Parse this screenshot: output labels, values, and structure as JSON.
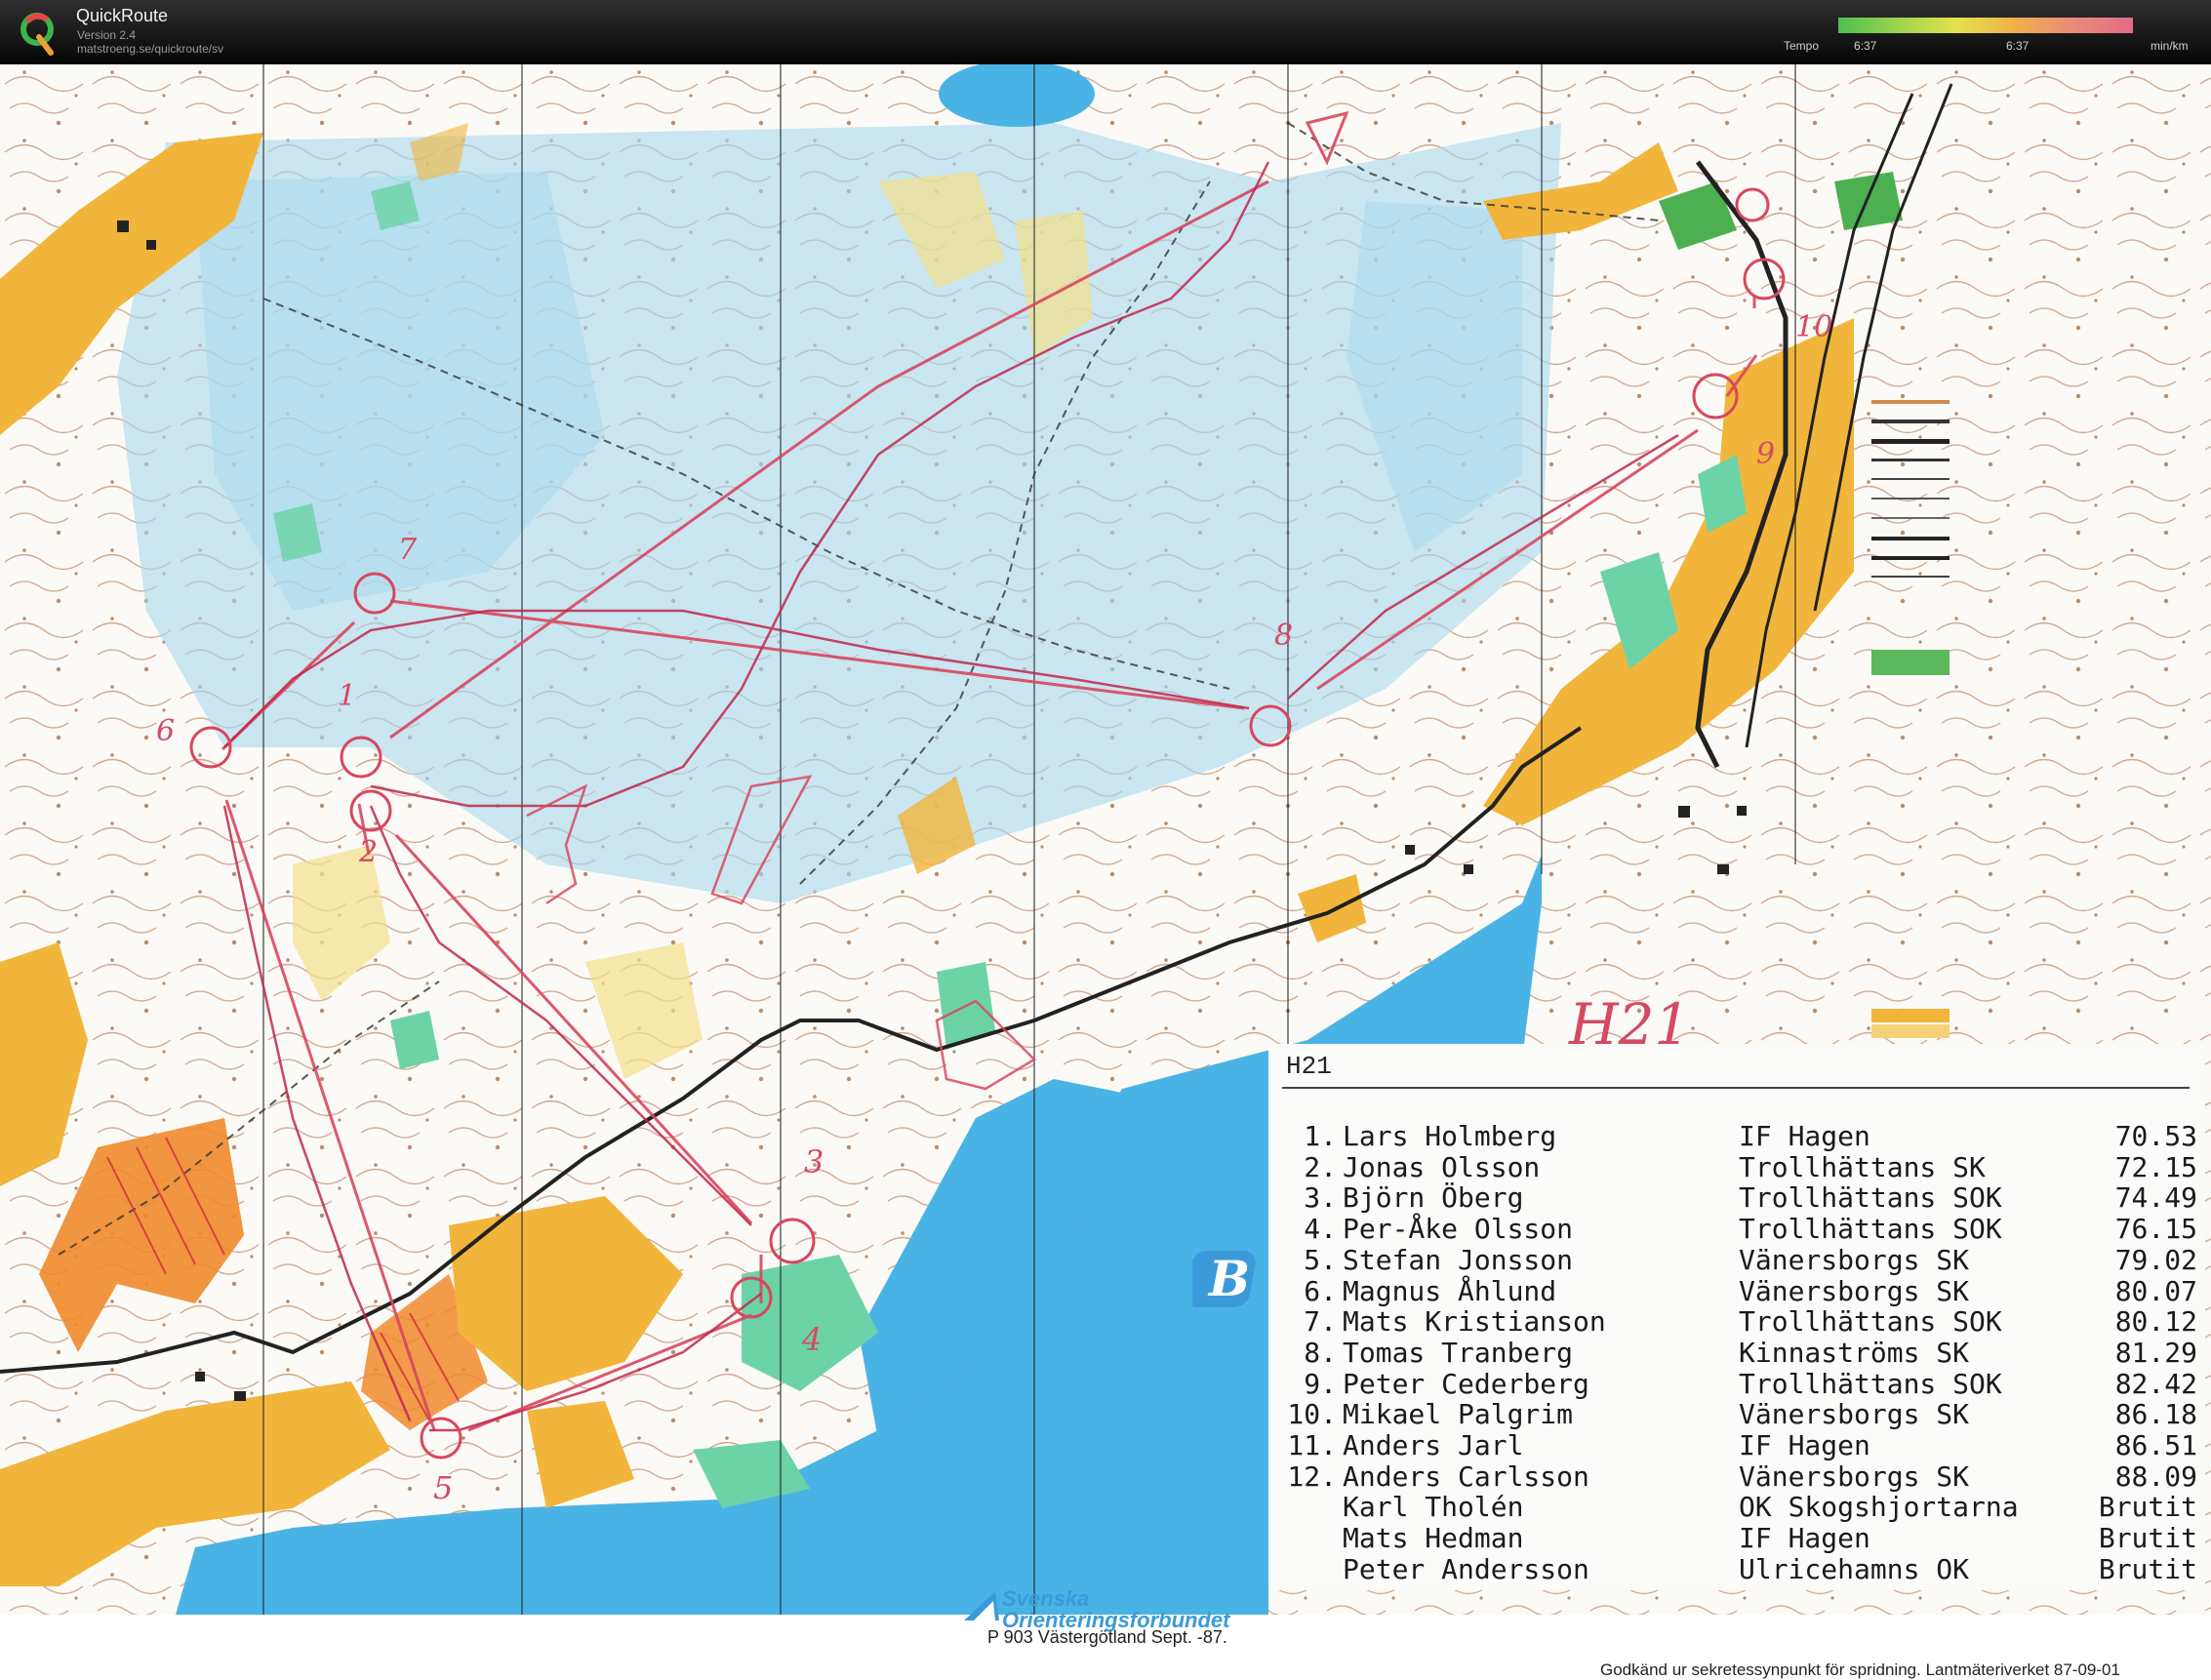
{
  "app": {
    "title": "QuickRoute",
    "version": "Version 2.4",
    "url": "matstroeng.se/quickroute/sv"
  },
  "tempo": {
    "label": "Tempo",
    "tick_left": "6:37",
    "tick_mid": "6:37",
    "unit": "min/km"
  },
  "map": {
    "controls": [
      "1",
      "2",
      "3",
      "4",
      "5",
      "6",
      "7",
      "8",
      "9",
      "10"
    ],
    "class_handwritten": "H21",
    "badge": "B",
    "federation": "Svenska Orienteringsforbundet",
    "print_info": "P 903 Västergötland Sept. -87.",
    "approval": "Godkänd ur sekretessynpunkt för spridning. Lantmäteriverket 87-09-01",
    "colors": {
      "route": "#d9465e",
      "water": "#4ab3e6",
      "marsh": "#a8d8ef",
      "open_land": "#f2b53b",
      "green": "#6cd3a6",
      "contour": "#a0522d"
    }
  },
  "results": {
    "class": "H21",
    "rows": [
      {
        "pos": "1.",
        "name": "Lars Holmberg",
        "club": "IF Hagen",
        "time": "70.53"
      },
      {
        "pos": "2.",
        "name": "Jonas Olsson",
        "club": "Trollhättans SK",
        "time": "72.15"
      },
      {
        "pos": "3.",
        "name": "Björn Öberg",
        "club": "Trollhättans SOK",
        "time": "74.49"
      },
      {
        "pos": "4.",
        "name": "Per-Åke Olsson",
        "club": "Trollhättans SOK",
        "time": "76.15"
      },
      {
        "pos": "5.",
        "name": "Stefan Jonsson",
        "club": "Vänersborgs SK",
        "time": "79.02"
      },
      {
        "pos": "6.",
        "name": "Magnus Åhlund",
        "club": "Vänersborgs SK",
        "time": "80.07"
      },
      {
        "pos": "7.",
        "name": "Mats Kristianson",
        "club": "Trollhättans SOK",
        "time": "80.12"
      },
      {
        "pos": "8.",
        "name": "Tomas Tranberg",
        "club": "Kinnaströms SK",
        "time": "81.29"
      },
      {
        "pos": "9.",
        "name": "Peter Cederberg",
        "club": "Trollhättans SOK",
        "time": "82.42"
      },
      {
        "pos": "10.",
        "name": "Mikael Palgrim",
        "club": "Vänersborgs SK",
        "time": "86.18"
      },
      {
        "pos": "11.",
        "name": "Anders Jarl",
        "club": "IF Hagen",
        "time": "86.51"
      },
      {
        "pos": "12.",
        "name": "Anders Carlsson",
        "club": "Vänersborgs SK",
        "time": "88.09"
      },
      {
        "pos": "",
        "name": "Karl Tholén",
        "club": "OK Skogshjortarna",
        "time": "Brutit"
      },
      {
        "pos": "",
        "name": "Mats Hedman",
        "club": "IF Hagen",
        "time": "Brutit"
      },
      {
        "pos": "",
        "name": "Peter Andersson",
        "club": "Ulricehamns OK",
        "time": "Brutit"
      }
    ]
  }
}
